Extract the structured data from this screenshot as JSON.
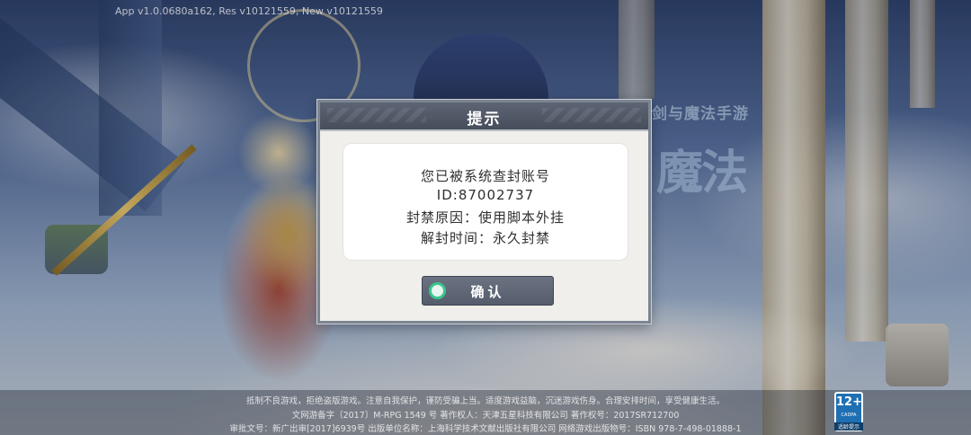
{
  "version_text": "App v1.0.0680a162, Res v10121559, New v10121559",
  "background": {
    "logo_tagline": "剑与魔法手游",
    "logo_title": "魔法"
  },
  "dialog": {
    "title": "提示",
    "message_lines": [
      "您已被系统查封账号",
      "ID:87002737",
      "封禁原因：使用脚本外挂",
      "解封时间：永久封禁"
    ],
    "confirm_label": "确认",
    "confirm_icon": "circle-check-icon",
    "colors": {
      "header": "#4f5766",
      "button": "#5f6777",
      "icon_ring": "#39c78e"
    }
  },
  "footer": {
    "line1": "抵制不良游戏，拒绝盗版游戏。注意自我保护，谨防受骗上当。适度游戏益脑，沉迷游戏伤身。合理安排时间，享受健康生活。",
    "line2": "文网游备字〔2017〕M-RPG 1549 号   著作权人：天津五星科技有限公司   著作权号：2017SR712700",
    "line3": "审批文号：新广出审[2017]6939号   出版单位名称：上海科学技术文献出版社有限公司   网络游戏出版物号：ISBN 978-7-498-01888-1"
  },
  "age_rating": {
    "label": "12+",
    "sub": "CADPA",
    "caption": "适龄提示"
  }
}
